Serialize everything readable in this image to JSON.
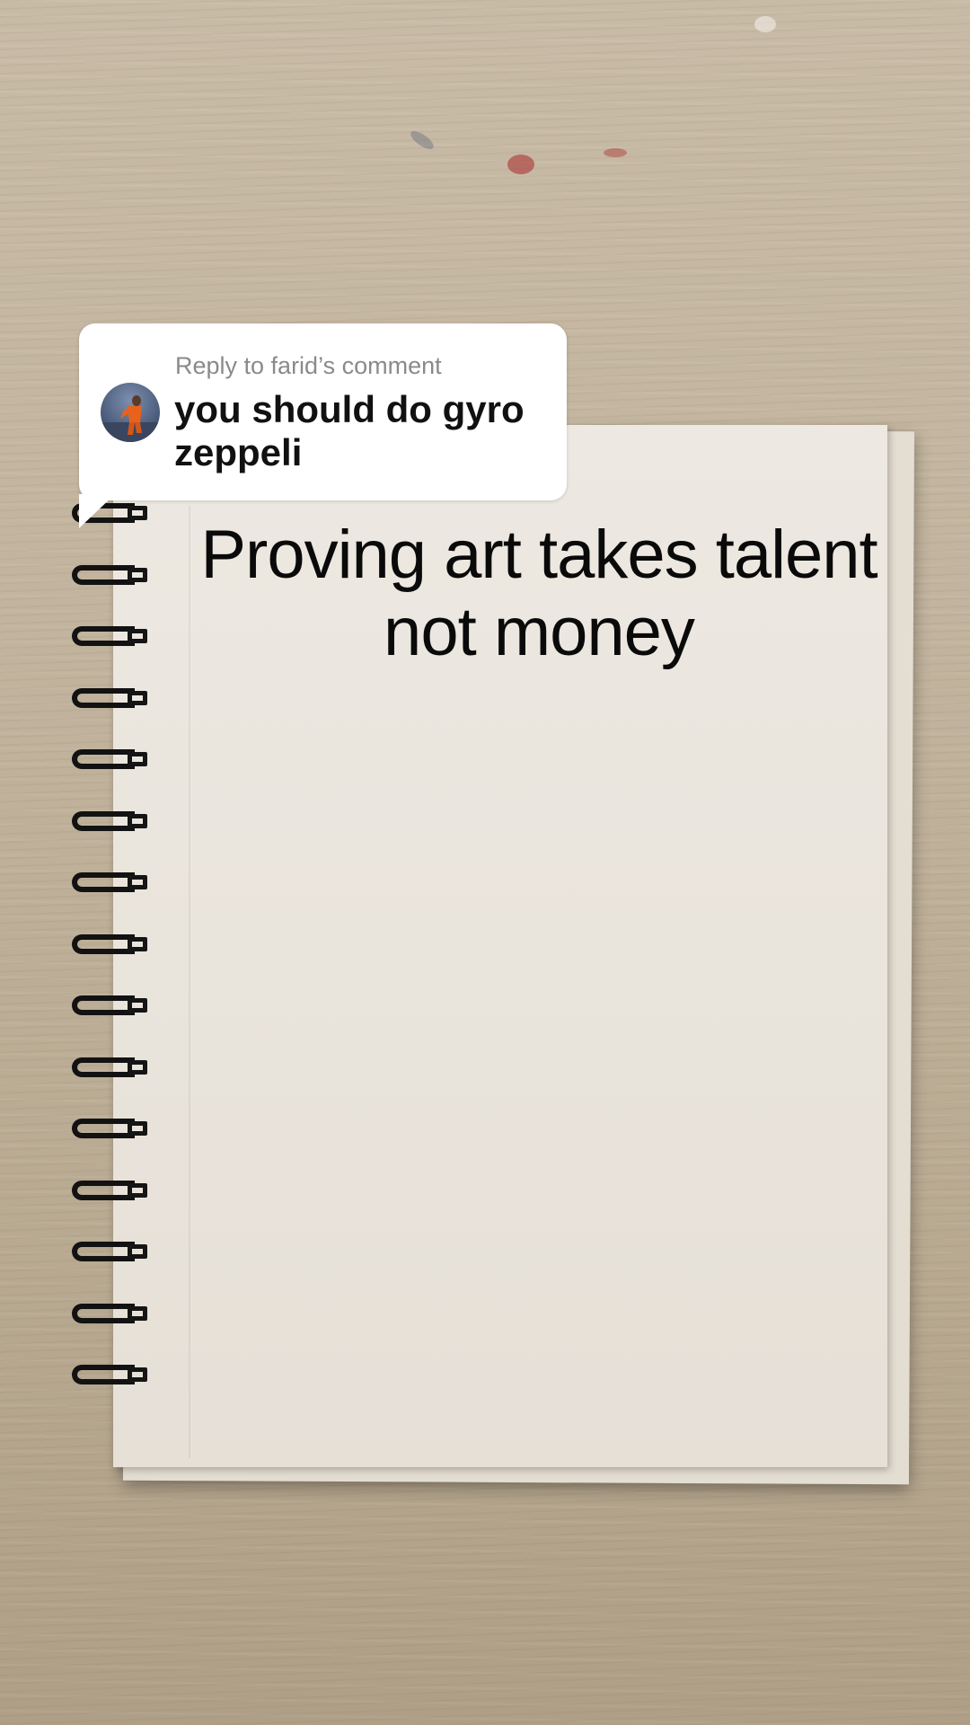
{
  "reply": {
    "label": "Reply to farid’s comment",
    "comment": "you should do gyro zeppeli"
  },
  "caption": {
    "line1": "Proving art takes talent",
    "line2": "not money"
  },
  "colors": {
    "bubble": "#ffffff",
    "caption_text": "#0a0a0a",
    "reply_label": "#8a8a8a",
    "desk": "#c2b49e",
    "page": "#ebe6de"
  },
  "icons": {
    "avatar": "user-avatar"
  }
}
